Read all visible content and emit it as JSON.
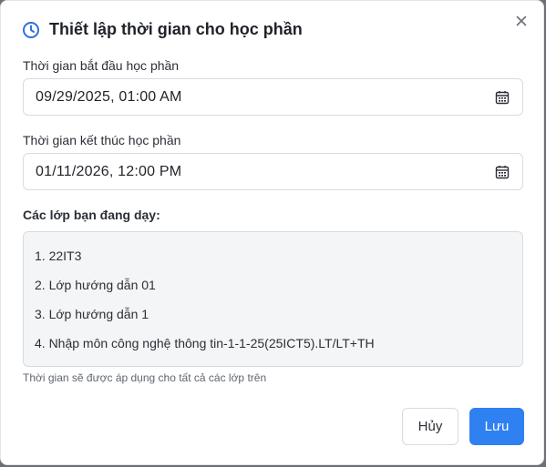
{
  "dialog": {
    "title": "Thiết lập thời gian cho học phần",
    "close_icon": "close-icon",
    "title_icon": "clock-icon"
  },
  "start": {
    "label": "Thời gian bắt đầu học phần",
    "value": "09/29/2025, 01:00 AM",
    "icon": "calendar-icon"
  },
  "end": {
    "label": "Thời gian kết thúc học phần",
    "value": "01/11/2026, 12:00 PM",
    "icon": "calendar-icon"
  },
  "classes": {
    "label": "Các lớp bạn đang dạy:",
    "items": [
      "1. 22IT3",
      "2. Lớp hướng dẫn 01",
      "3. Lớp hướng dẫn 1",
      "4. Nhập môn công nghệ thông tin-1-1-25(25ICT5).LT/LT+TH"
    ],
    "note": "Thời gian sẽ được áp dụng cho tất cả các lớp trên"
  },
  "actions": {
    "cancel_label": "Hủy",
    "save_label": "Lưu"
  },
  "colors": {
    "accent": "#2f80f0",
    "title_icon": "#2f6fe0"
  }
}
